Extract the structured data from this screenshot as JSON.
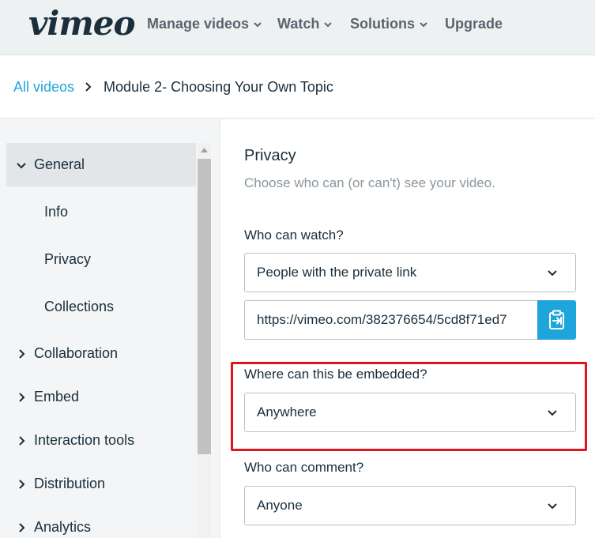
{
  "header": {
    "logo": "vimeo",
    "nav": [
      {
        "label": "Manage videos",
        "has_dropdown": true
      },
      {
        "label": "Watch",
        "has_dropdown": true
      },
      {
        "label": "Solutions",
        "has_dropdown": true
      },
      {
        "label": "Upgrade",
        "has_dropdown": false
      }
    ]
  },
  "breadcrumb": {
    "link": "All videos",
    "current": "Module 2- Choosing Your Own Topic"
  },
  "sidebar": {
    "general": "General",
    "sub_items": [
      "Info",
      "Privacy",
      "Collections"
    ],
    "items": [
      "Collaboration",
      "Embed",
      "Interaction tools",
      "Distribution",
      "Analytics"
    ]
  },
  "privacy": {
    "title": "Privacy",
    "description": "Choose who can (or can't) see your video.",
    "who_can_watch": {
      "label": "Who can watch?",
      "value": "People with the private link"
    },
    "private_link": "https://vimeo.com/382376654/5cd8f71ed7",
    "embed": {
      "label": "Where can this be embedded?",
      "value": "Anywhere"
    },
    "comment": {
      "label": "Who can comment?",
      "value": "Anyone"
    }
  },
  "colors": {
    "accent": "#1ea6dc",
    "highlight": "#e0141b",
    "text": "#1a2e3b"
  }
}
